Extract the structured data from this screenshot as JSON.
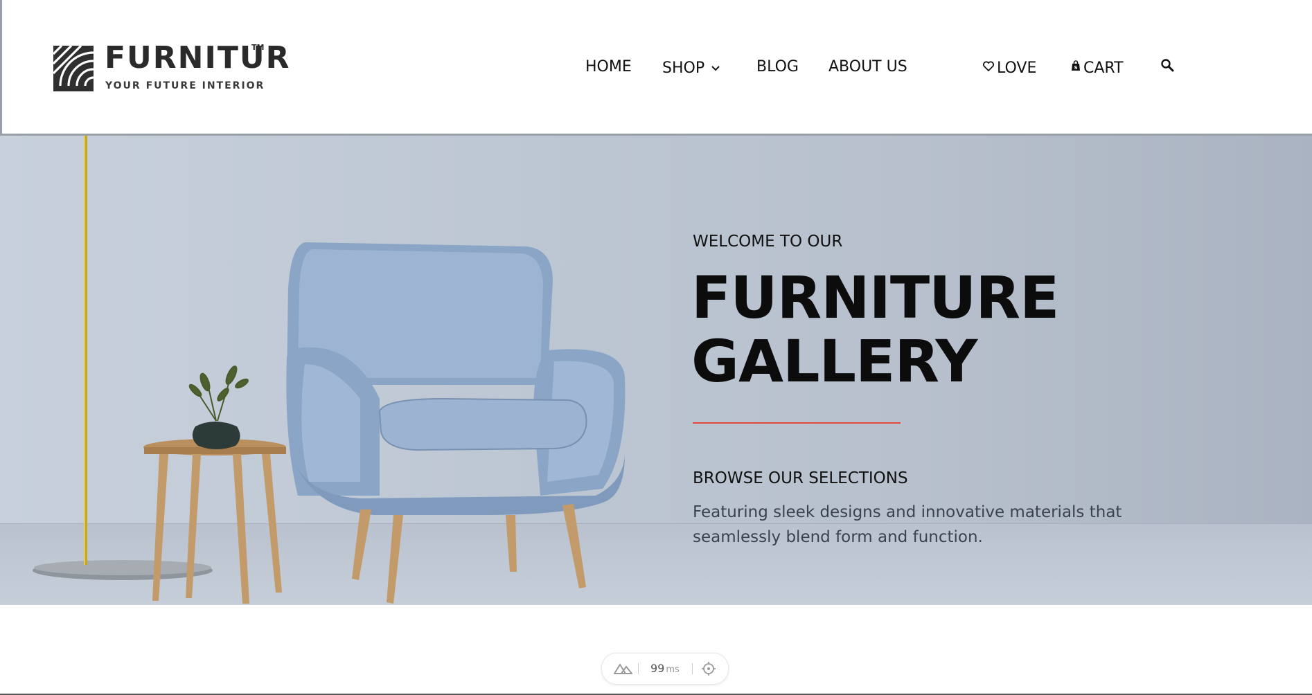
{
  "header": {
    "logo": {
      "name": "FURNITUR",
      "trademark": "TM",
      "tagline": "YOUR FUTURE INTERIOR"
    },
    "nav": [
      {
        "label": "HOME"
      },
      {
        "label": "SHOP"
      },
      {
        "label": "BLOG"
      },
      {
        "label": "ABOUT US"
      }
    ],
    "actions": [
      {
        "label": "LOVE",
        "icon": "heart-icon"
      },
      {
        "label": "CART",
        "icon": "shopping-bag-icon"
      },
      {
        "label": "",
        "icon": "search-icon"
      }
    ]
  },
  "hero": {
    "eyebrow": "WELCOME TO OUR",
    "title_line1": "FURNITURE",
    "title_line2": "GALLERY",
    "subheading": "BROWSE OUR SELECTIONS",
    "description": "Featuring sleek designs and innovative materials that seamlessly blend form and function.",
    "accent_color": "#e2483b"
  },
  "perf_badge": {
    "value": "99",
    "unit": "ms",
    "icons": [
      "nuxt-icon",
      "crosshair-icon"
    ]
  }
}
